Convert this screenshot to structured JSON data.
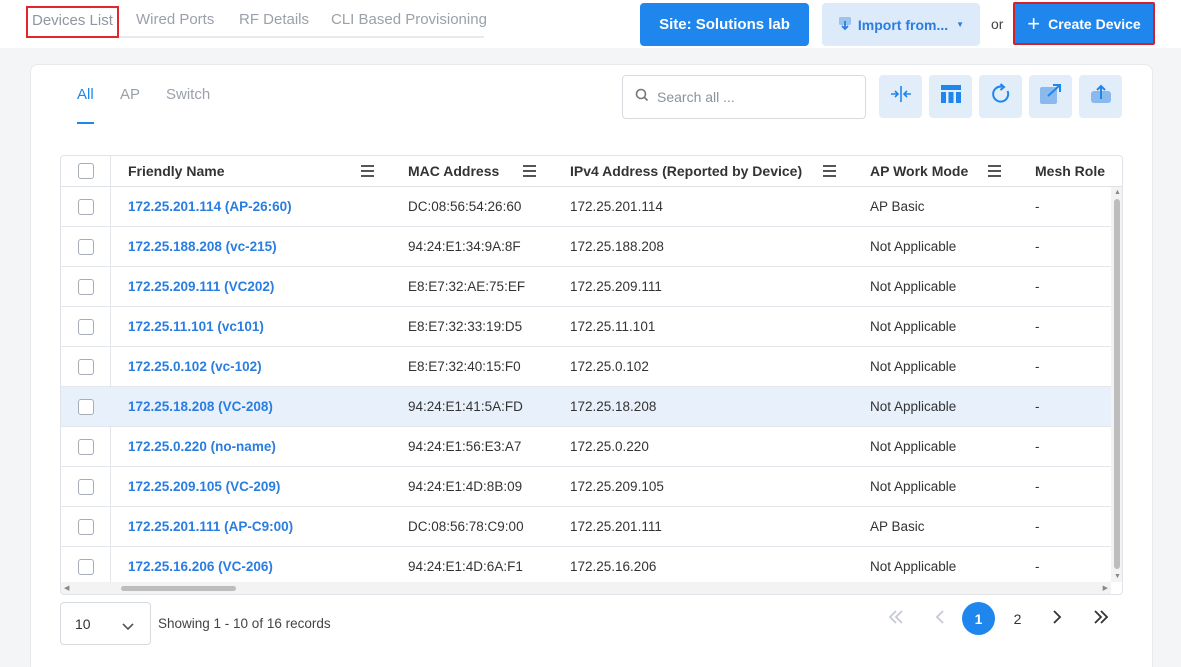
{
  "top_tabs": [
    {
      "label": "Devices List",
      "active": true
    },
    {
      "label": "Wired Ports"
    },
    {
      "label": "RF Details"
    },
    {
      "label": "CLI Based Provisioning"
    }
  ],
  "site_button": "Site:  Solutions lab",
  "import_button": "Import from...",
  "or_label": "or",
  "create_button": "Create Device",
  "sub_tabs": [
    {
      "label": "All",
      "active": true
    },
    {
      "label": "AP"
    },
    {
      "label": "Switch"
    }
  ],
  "search": {
    "placeholder": "Search all ..."
  },
  "toolbar_icons": [
    "collapse-columns-icon",
    "column-layout-icon",
    "refresh-icon",
    "export-icon",
    "upload-icon"
  ],
  "table": {
    "columns": [
      "Friendly Name",
      "MAC Address",
      "IPv4 Address (Reported by Device)",
      "AP Work Mode",
      "Mesh Role"
    ],
    "rows": [
      {
        "name": "172.25.201.114 (AP-26:60)",
        "mac": "DC:08:56:54:26:60",
        "ip": "172.25.201.114",
        "mode": "AP Basic",
        "mesh": "-"
      },
      {
        "name": "172.25.188.208 (vc-215)",
        "mac": "94:24:E1:34:9A:8F",
        "ip": "172.25.188.208",
        "mode": "Not Applicable",
        "mesh": "-"
      },
      {
        "name": "172.25.209.111 (VC202)",
        "mac": "E8:E7:32:AE:75:EF",
        "ip": "172.25.209.111",
        "mode": "Not Applicable",
        "mesh": "-"
      },
      {
        "name": "172.25.11.101 (vc101)",
        "mac": "E8:E7:32:33:19:D5",
        "ip": "172.25.11.101",
        "mode": "Not Applicable",
        "mesh": "-"
      },
      {
        "name": "172.25.0.102 (vc-102)",
        "mac": "E8:E7:32:40:15:F0",
        "ip": "172.25.0.102",
        "mode": "Not Applicable",
        "mesh": "-"
      },
      {
        "name": "172.25.18.208 (VC-208)",
        "mac": "94:24:E1:41:5A:FD",
        "ip": "172.25.18.208",
        "mode": "Not Applicable",
        "mesh": "-"
      },
      {
        "name": "172.25.0.220 (no-name)",
        "mac": "94:24:E1:56:E3:A7",
        "ip": "172.25.0.220",
        "mode": "Not Applicable",
        "mesh": "-"
      },
      {
        "name": "172.25.209.105 (VC-209)",
        "mac": "94:24:E1:4D:8B:09",
        "ip": "172.25.209.105",
        "mode": "Not Applicable",
        "mesh": "-"
      },
      {
        "name": "172.25.201.111 (AP-C9:00)",
        "mac": "DC:08:56:78:C9:00",
        "ip": "172.25.201.111",
        "mode": "AP Basic",
        "mesh": "-"
      },
      {
        "name": "172.25.16.206 (VC-206)",
        "mac": "94:24:E1:4D:6A:F1",
        "ip": "172.25.16.206",
        "mode": "Not Applicable",
        "mesh": "-"
      }
    ],
    "highlighted_row": 5
  },
  "footer": {
    "page_size": "10",
    "records_text": "Showing 1 - 10 of 16 records",
    "pages": [
      "1",
      "2"
    ],
    "current_page": "1"
  },
  "colors": {
    "accent": "#1f86ee",
    "highlight_border": "#e3262b",
    "row_highlight": "#e8f1fb"
  }
}
